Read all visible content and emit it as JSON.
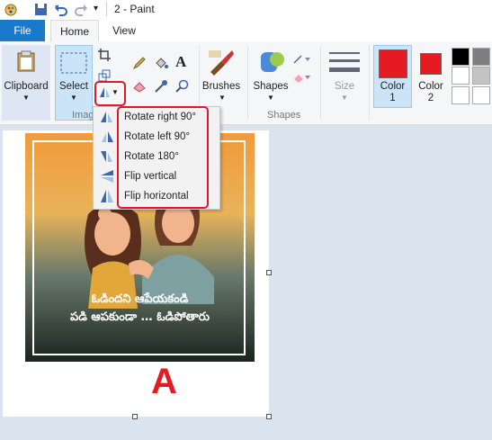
{
  "window": {
    "title": "2 - Paint"
  },
  "tabs": {
    "file": "File",
    "home": "Home",
    "view": "View"
  },
  "ribbon": {
    "clipboard": "Clipboard",
    "select": "Select",
    "image_group": "Image",
    "brushes": "Brushes",
    "shapes": "Shapes",
    "shapes_group": "Shapes",
    "size": "Size",
    "color1": "Color",
    "color1_num": "1",
    "color2": "Color",
    "color2_num": "2"
  },
  "rotate_menu": {
    "items": [
      "Rotate right 90°",
      "Rotate left 90°",
      "Rotate 180°",
      "Flip vertical",
      "Flip horizontal"
    ]
  },
  "canvas": {
    "caption_line1": "ఓడిందని ఆపేయకండి",
    "caption_line2": "పడి ఆపకుండా … ఓడిపోతారు",
    "annotation": "A"
  },
  "colors": {
    "accent_red": "#e0192a",
    "color1": "#e51b23",
    "color2": "#e51b23",
    "file_tab": "#1979ca"
  },
  "palette": [
    "#000000",
    "#7f7f7f",
    "#ffffff",
    "#c3c3c3",
    "#ffffff",
    "#ffffff"
  ]
}
